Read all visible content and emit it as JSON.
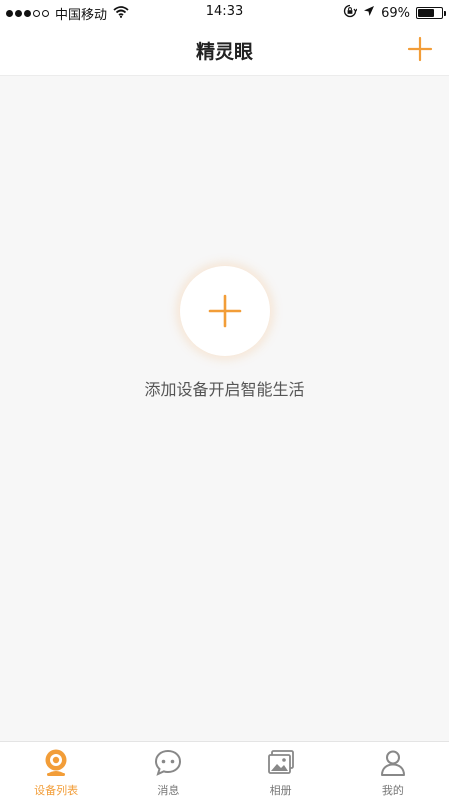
{
  "status_bar": {
    "carrier": "中国移动",
    "time": "14:33",
    "battery_percent": "69%",
    "battery_level": 0.69,
    "signal_dots": [
      true,
      true,
      true,
      false,
      false
    ],
    "icons": [
      "signal-dots-icon",
      "wifi-icon",
      "rotation-lock-icon",
      "location-arrow-icon",
      "battery-icon"
    ]
  },
  "nav": {
    "title": "精灵眼",
    "add_icon": "plus-icon"
  },
  "empty_state": {
    "add_icon": "plus-icon",
    "message": "添加设备开启智能生活"
  },
  "colors": {
    "accent": "#f29d38",
    "background": "#f7f7f7",
    "tab_inactive": "#888888"
  },
  "tabs": [
    {
      "label": "设备列表",
      "icon": "camera-icon",
      "active": true
    },
    {
      "label": "消息",
      "icon": "chat-bubble-icon",
      "active": false
    },
    {
      "label": "相册",
      "icon": "photo-album-icon",
      "active": false
    },
    {
      "label": "我的",
      "icon": "user-icon",
      "active": false
    }
  ]
}
